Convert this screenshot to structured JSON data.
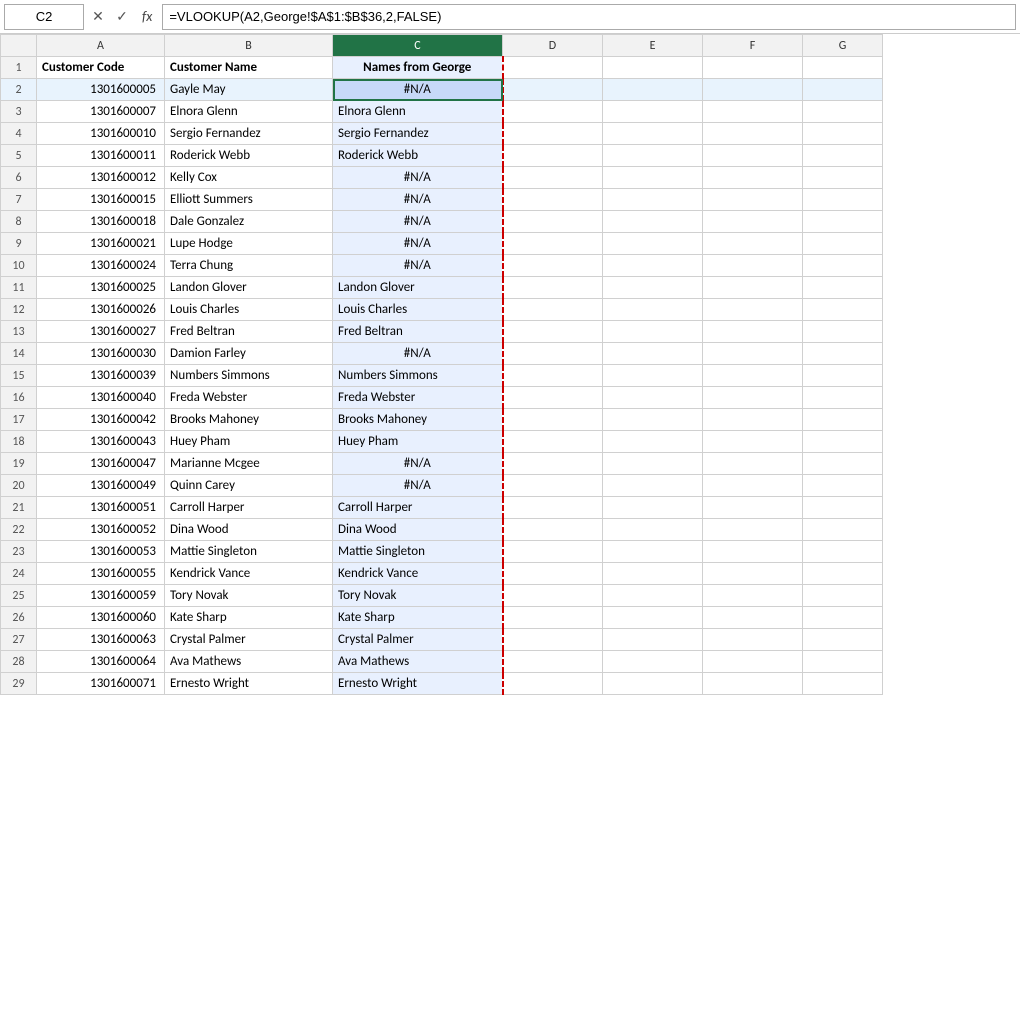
{
  "formulaBar": {
    "cellRef": "C2",
    "fxLabel": "fx",
    "formula": "=VLOOKUP(A2,George!$A$1:$B$36,2,FALSE)"
  },
  "columns": [
    {
      "id": "A",
      "label": "A"
    },
    {
      "id": "B",
      "label": "B"
    },
    {
      "id": "C",
      "label": "C",
      "selected": true
    },
    {
      "id": "D",
      "label": "D"
    },
    {
      "id": "E",
      "label": "E"
    },
    {
      "id": "F",
      "label": "F"
    },
    {
      "id": "G",
      "label": "G"
    }
  ],
  "headers": {
    "colA": "Customer Code",
    "colB": "Customer Name",
    "colC": "Names from George"
  },
  "rows": [
    {
      "row": 2,
      "a": "1301600005",
      "b": "Gayle May",
      "c": "#N/A",
      "cType": "na"
    },
    {
      "row": 3,
      "a": "1301600007",
      "b": "Elnora Glenn",
      "c": "Elnora Glenn",
      "cType": "data"
    },
    {
      "row": 4,
      "a": "1301600010",
      "b": "Sergio Fernandez",
      "c": "Sergio Fernandez",
      "cType": "data"
    },
    {
      "row": 5,
      "a": "1301600011",
      "b": "Roderick Webb",
      "c": "Roderick Webb",
      "cType": "data"
    },
    {
      "row": 6,
      "a": "1301600012",
      "b": "Kelly Cox",
      "c": "#N/A",
      "cType": "na"
    },
    {
      "row": 7,
      "a": "1301600015",
      "b": "Elliott Summers",
      "c": "#N/A",
      "cType": "na"
    },
    {
      "row": 8,
      "a": "1301600018",
      "b": "Dale Gonzalez",
      "c": "#N/A",
      "cType": "na"
    },
    {
      "row": 9,
      "a": "1301600021",
      "b": "Lupe Hodge",
      "c": "#N/A",
      "cType": "na"
    },
    {
      "row": 10,
      "a": "1301600024",
      "b": "Terra Chung",
      "c": "#N/A",
      "cType": "na"
    },
    {
      "row": 11,
      "a": "1301600025",
      "b": "Landon Glover",
      "c": "Landon Glover",
      "cType": "data"
    },
    {
      "row": 12,
      "a": "1301600026",
      "b": "Louis Charles",
      "c": "Louis Charles",
      "cType": "data"
    },
    {
      "row": 13,
      "a": "1301600027",
      "b": "Fred Beltran",
      "c": "Fred Beltran",
      "cType": "data"
    },
    {
      "row": 14,
      "a": "1301600030",
      "b": "Damion Farley",
      "c": "#N/A",
      "cType": "na"
    },
    {
      "row": 15,
      "a": "1301600039",
      "b": "Numbers Simmons",
      "c": "Numbers Simmons",
      "cType": "data"
    },
    {
      "row": 16,
      "a": "1301600040",
      "b": "Freda Webster",
      "c": "Freda Webster",
      "cType": "data"
    },
    {
      "row": 17,
      "a": "1301600042",
      "b": "Brooks Mahoney",
      "c": "Brooks Mahoney",
      "cType": "data"
    },
    {
      "row": 18,
      "a": "1301600043",
      "b": "Huey Pham",
      "c": "Huey Pham",
      "cType": "data"
    },
    {
      "row": 19,
      "a": "1301600047",
      "b": "Marianne Mcgee",
      "c": "#N/A",
      "cType": "na"
    },
    {
      "row": 20,
      "a": "1301600049",
      "b": "Quinn Carey",
      "c": "#N/A",
      "cType": "na"
    },
    {
      "row": 21,
      "a": "1301600051",
      "b": "Carroll Harper",
      "c": "Carroll Harper",
      "cType": "data"
    },
    {
      "row": 22,
      "a": "1301600052",
      "b": "Dina Wood",
      "c": "Dina Wood",
      "cType": "data"
    },
    {
      "row": 23,
      "a": "1301600053",
      "b": "Mattie Singleton",
      "c": "Mattie Singleton",
      "cType": "data"
    },
    {
      "row": 24,
      "a": "1301600055",
      "b": "Kendrick Vance",
      "c": "Kendrick Vance",
      "cType": "data"
    },
    {
      "row": 25,
      "a": "1301600059",
      "b": "Tory Novak",
      "c": "Tory Novak",
      "cType": "data"
    },
    {
      "row": 26,
      "a": "1301600060",
      "b": "Kate Sharp",
      "c": "Kate Sharp",
      "cType": "data"
    },
    {
      "row": 27,
      "a": "1301600063",
      "b": "Crystal Palmer",
      "c": "Crystal Palmer",
      "cType": "data"
    },
    {
      "row": 28,
      "a": "1301600064",
      "b": "Ava Mathews",
      "c": "Ava Mathews",
      "cType": "data"
    },
    {
      "row": 29,
      "a": "1301600071",
      "b": "Ernesto Wright",
      "c": "Ernesto Wright",
      "cType": "data"
    }
  ],
  "icons": {
    "cancel": "✕",
    "confirm": "✓",
    "fx": "fx"
  }
}
